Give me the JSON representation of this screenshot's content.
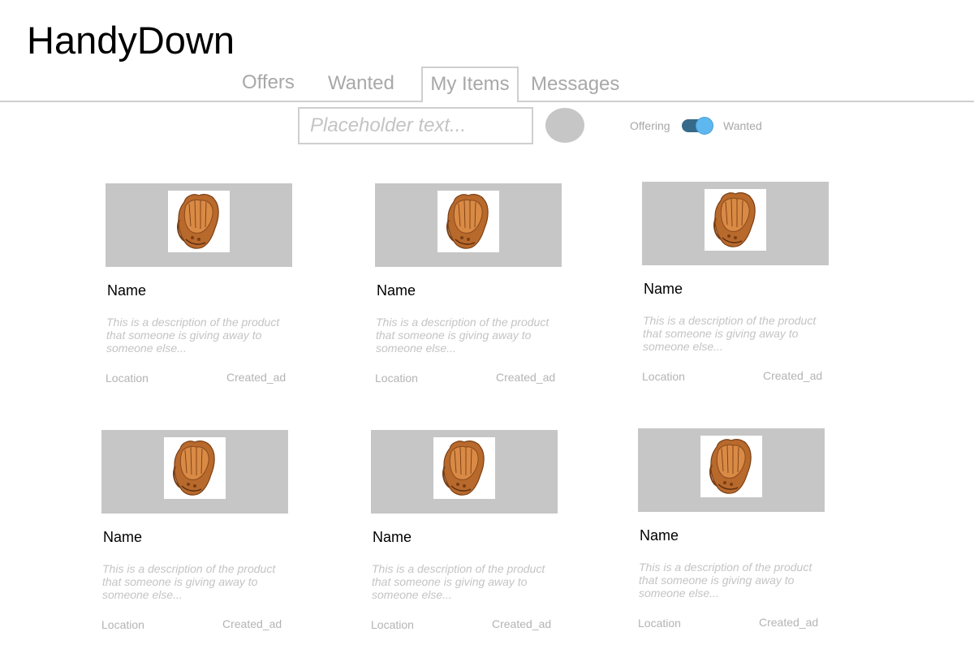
{
  "app": {
    "title": "HandyDown"
  },
  "tabs": [
    {
      "label": "Offers",
      "active": false
    },
    {
      "label": "Wanted",
      "active": false
    },
    {
      "label": "My Items",
      "active": true
    },
    {
      "label": "Messages",
      "active": false
    }
  ],
  "search": {
    "placeholder": "Placeholder text...",
    "value": ""
  },
  "toggle": {
    "left_label": "Offering",
    "right_label": "Wanted",
    "state": "on",
    "track_color": "#356a8a",
    "knob_color": "#5fb7ef"
  },
  "items": [
    {
      "image_icon": "baseball-glove-icon",
      "name": "Name",
      "description": "This is a description of the product that someone is giving away to someone else...",
      "location": "Location",
      "created": "Created_ad"
    },
    {
      "image_icon": "baseball-glove-icon",
      "name": "Name",
      "description": "This is a description of the product that someone is giving away to someone else...",
      "location": "Location",
      "created": "Created_ad"
    },
    {
      "image_icon": "baseball-glove-icon",
      "name": "Name",
      "description": "This is a description of the product that someone is giving away to someone else...",
      "location": "Location",
      "created": "Created_ad"
    },
    {
      "image_icon": "baseball-glove-icon",
      "name": "Name",
      "description": "This is a description of the product that someone is giving away to someone else...",
      "location": "Location",
      "created": "Created_ad"
    },
    {
      "image_icon": "baseball-glove-icon",
      "name": "Name",
      "description": "This is a description of the product that someone is giving away to someone else...",
      "location": "Location",
      "created": "Created_ad"
    },
    {
      "image_icon": "baseball-glove-icon",
      "name": "Name",
      "description": "This is a description of the product that someone is giving away to someone else...",
      "location": "Location",
      "created": "Created_ad"
    }
  ],
  "colors": {
    "image_placeholder": "#c6c6c6",
    "muted_text": "#a8a8a8",
    "divider": "#cfcfcf"
  }
}
